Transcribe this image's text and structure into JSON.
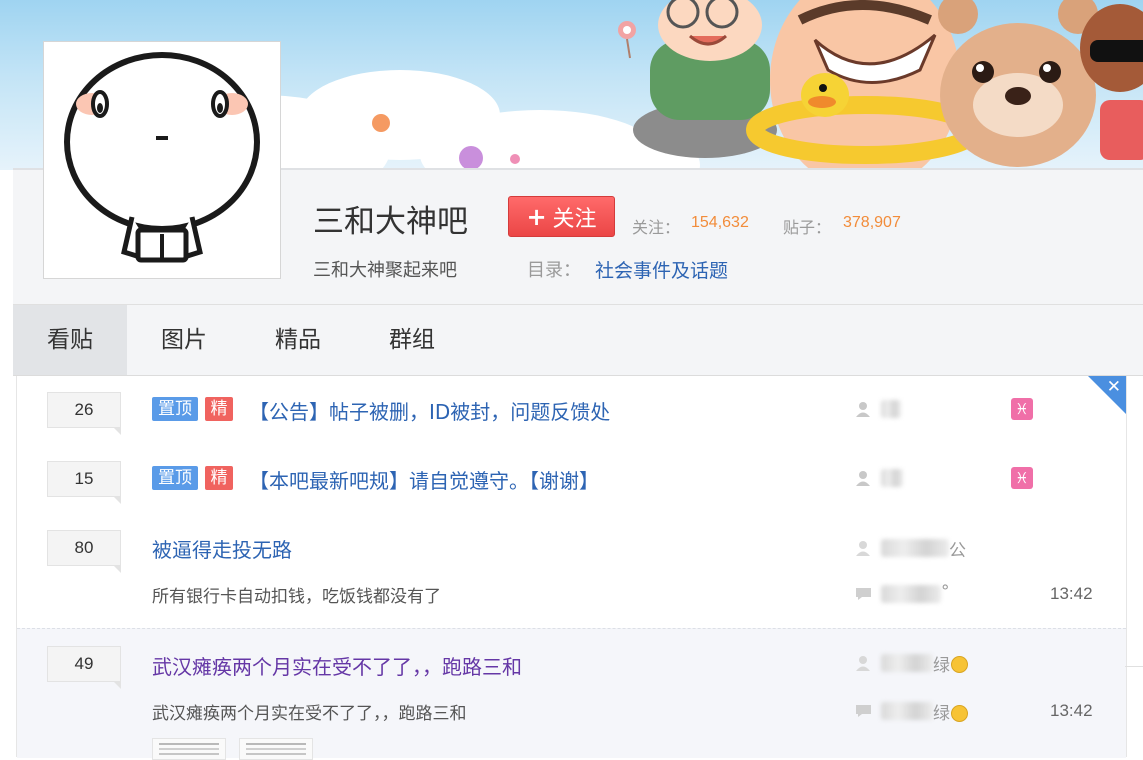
{
  "forum": {
    "name": "三和大神吧",
    "follow_label": "关注",
    "follow_plus": "+",
    "followers_label": "关注：",
    "followers_count": "154,632",
    "posts_label": "贴子：",
    "posts_count": "378,907",
    "slogan": "三和大神聚起来吧",
    "directory_label": "目录：",
    "directory_value": "社会事件及话题"
  },
  "tabs": [
    {
      "label": "看贴",
      "active": true
    },
    {
      "label": "图片",
      "active": false
    },
    {
      "label": "精品",
      "active": false
    },
    {
      "label": "群组",
      "active": false
    }
  ],
  "threads": [
    {
      "replies": "26",
      "tags": [
        "置顶",
        "精"
      ],
      "title": "【公告】帖子被删，ID被封，问题反馈处",
      "author_icon": "user-icon",
      "zodiac": "♓"
    },
    {
      "replies": "15",
      "tags": [
        "置顶",
        "精"
      ],
      "title": "【本吧最新吧规】请自觉遵守。【谢谢】",
      "author_icon": "user-icon",
      "zodiac": "♓"
    },
    {
      "replies": "80",
      "title": "被逼得走投无路",
      "abstract": "所有银行卡自动扣钱，吃饭钱都没有了",
      "author_tail": "公",
      "last_reply_tail": "°",
      "time": "13:42"
    },
    {
      "replies": "49",
      "title": "武汉瘫痪两个月实在受不了了，，跑路三和",
      "abstract": "武汉瘫痪两个月实在受不了了，，跑路三和",
      "author_tail": "绿",
      "last_reply_tail": "绿",
      "time": "13:42"
    }
  ],
  "icons": {
    "close": "close-icon",
    "user": "user-icon",
    "reply": "reply-icon",
    "zodiac": "pisces-icon",
    "emoji": "sad-face-icon"
  },
  "colors": {
    "link": "#2d64b3",
    "visited": "#6537a6",
    "accent_red": "#eb4646",
    "count_orange": "#f28c3a",
    "top_tag": "#5a9be8",
    "good_tag": "#f0635f"
  }
}
